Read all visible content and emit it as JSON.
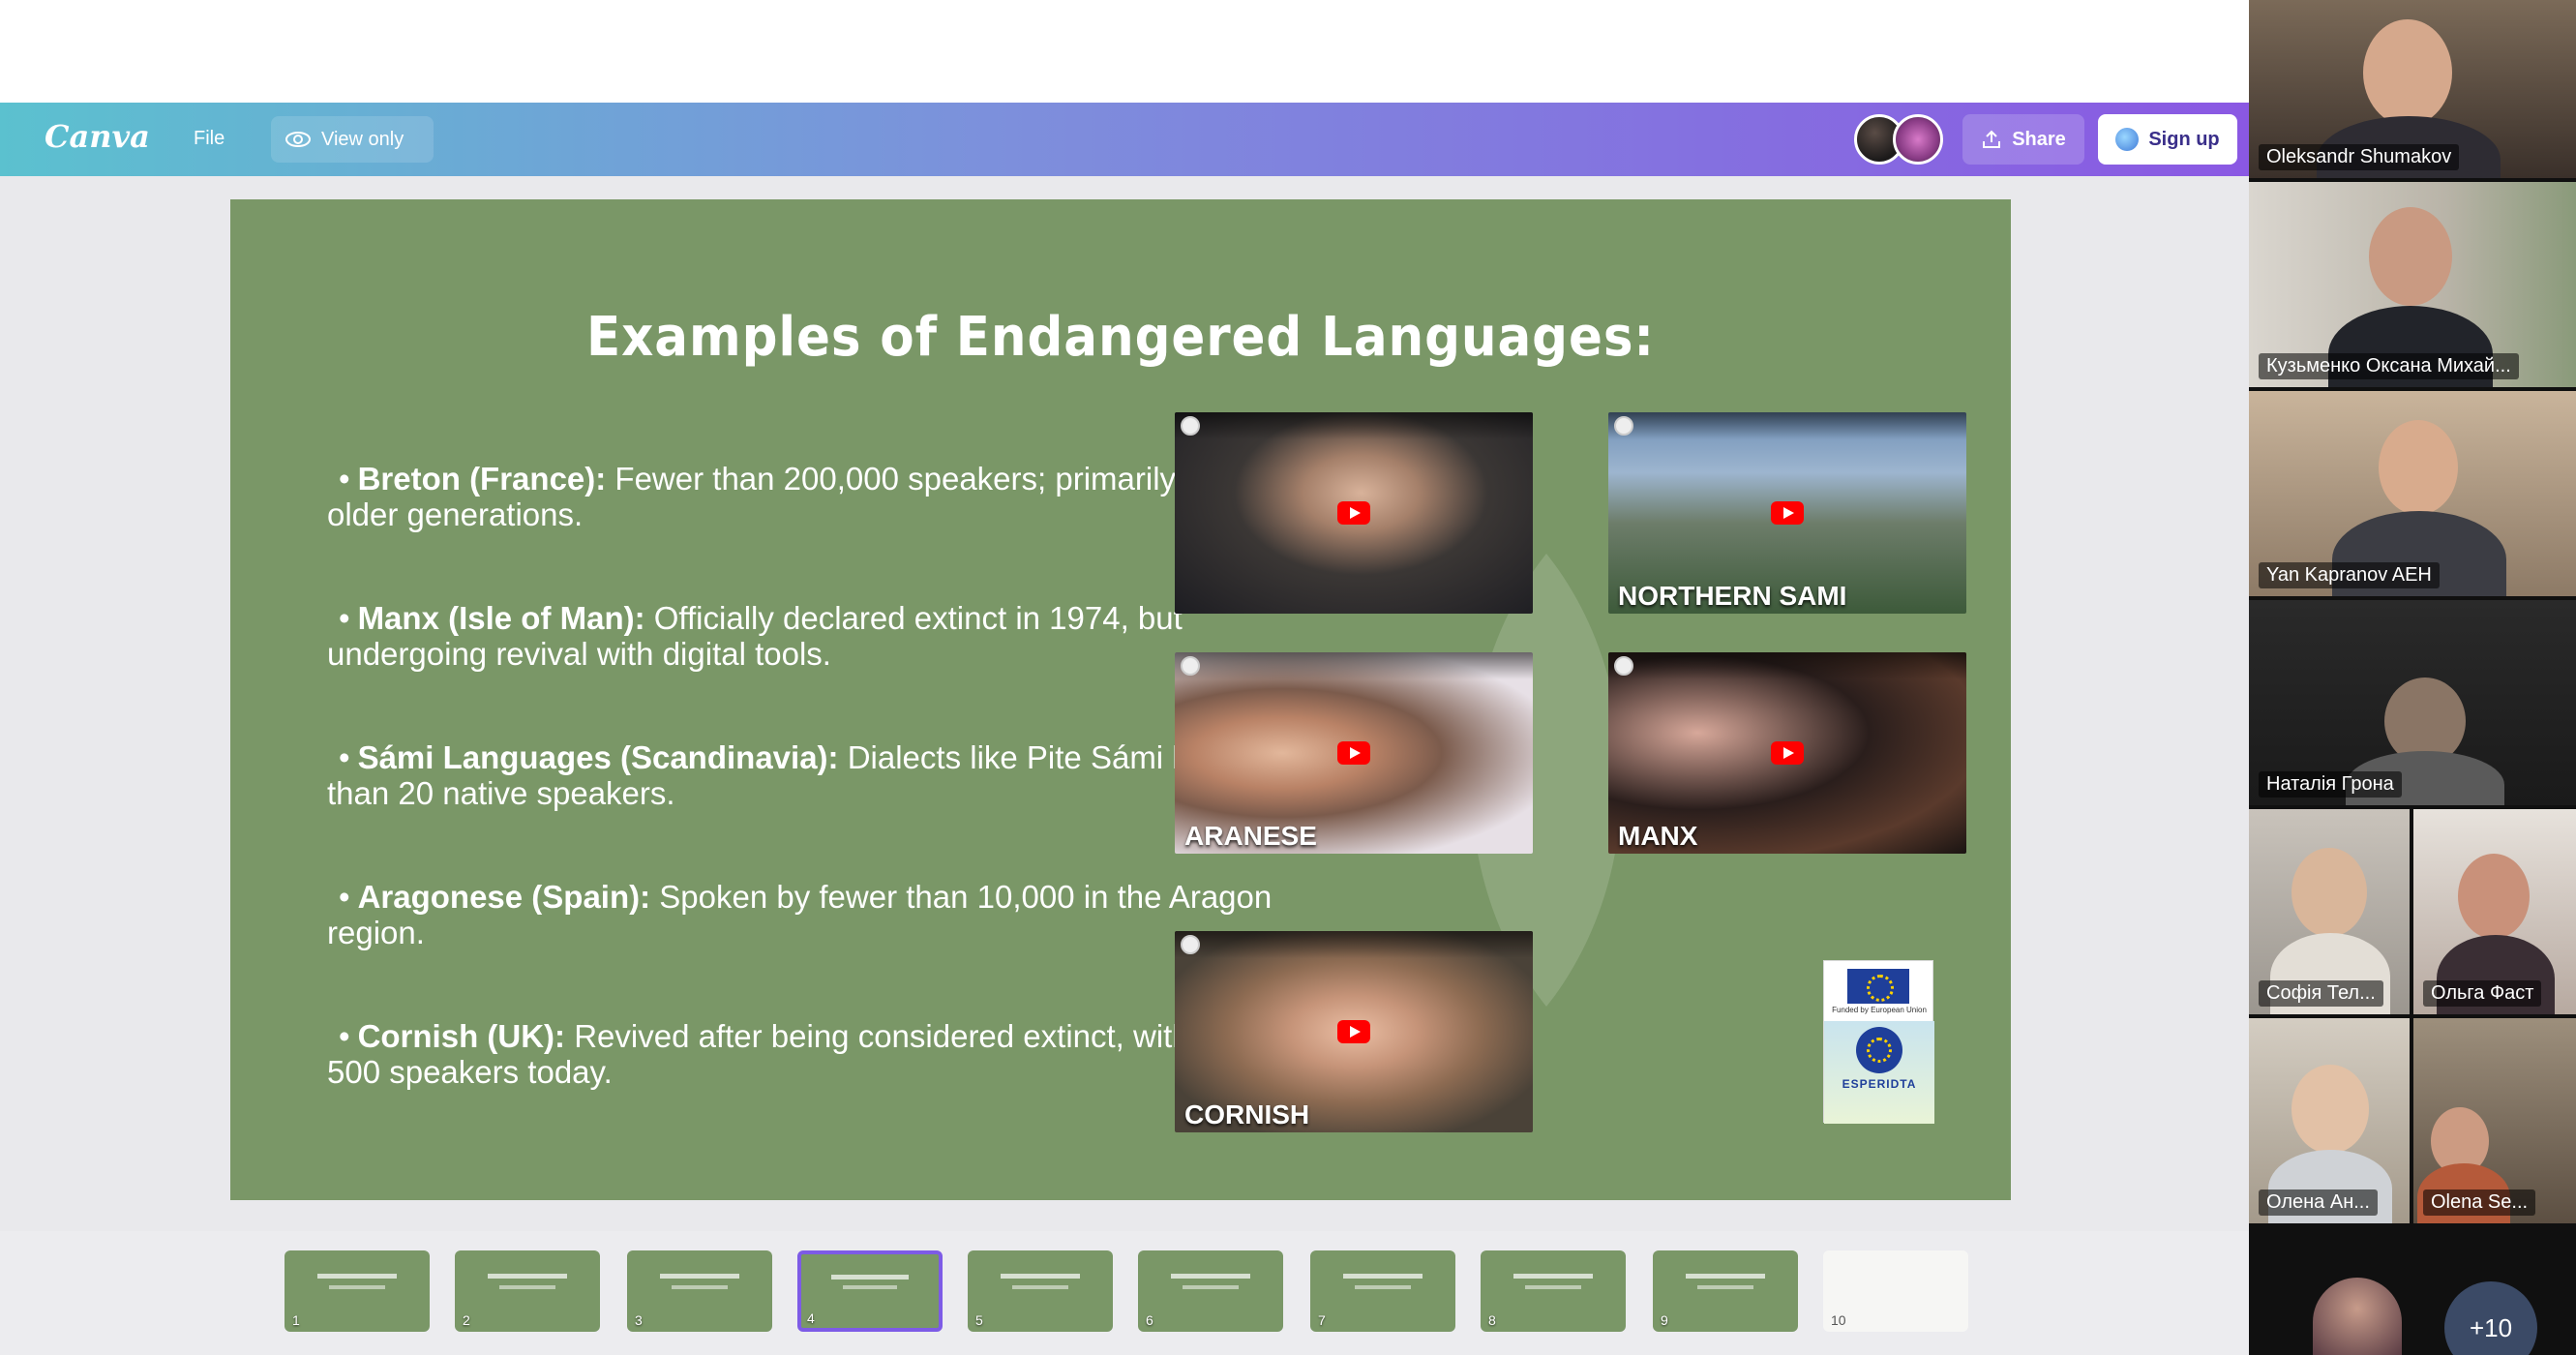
{
  "canva": {
    "logo": "Canva",
    "file_label": "File",
    "view_only_label": "View only",
    "share_label": "Share",
    "signup_label": "Sign up",
    "brand_gradient": [
      "#5bc1cf",
      "#8a58e3"
    ]
  },
  "slide": {
    "title": "Examples of Endangered Languages:",
    "background": "#7a9767",
    "bullets": [
      {
        "term": "Breton (France):",
        "text": " Fewer than 200,000 speakers; primarily spoken by older generations."
      },
      {
        "term": "Manx (Isle of Man):",
        "text": " Officially declared extinct in 1974, but undergoing revival with digital tools."
      },
      {
        "term": "Sámi Languages (Scandinavia):",
        "text": " Dialects like Pite Sámi have fewer than 20 native speakers."
      },
      {
        "term": "Aragonese (Spain):",
        "text": " Spoken by fewer than 10,000 in the Aragon region."
      },
      {
        "term": "Cornish (UK):",
        "text": " Revived after being considered extinct, with about 500 speakers today."
      }
    ],
    "videos": [
      {
        "caption": ""
      },
      {
        "caption": "NORTHERN SAMI"
      },
      {
        "caption": "ARANESE"
      },
      {
        "caption": "MANX"
      },
      {
        "caption": "CORNISH"
      }
    ],
    "eu_logo": {
      "funded_text": "Funded by European Union",
      "name": "ESPERIDTA"
    }
  },
  "thumbnails": [
    {
      "num": "1"
    },
    {
      "num": "2"
    },
    {
      "num": "3"
    },
    {
      "num": "4",
      "active": true
    },
    {
      "num": "5"
    },
    {
      "num": "6"
    },
    {
      "num": "7"
    },
    {
      "num": "8"
    },
    {
      "num": "9"
    },
    {
      "num": "10"
    }
  ],
  "participants": [
    {
      "name": "Oleksandr Shumakov"
    },
    {
      "name": "Кузьменко Оксана Михай..."
    },
    {
      "name": "Yan Kapranov AEH"
    },
    {
      "name": "Наталія Грона"
    },
    {
      "name": "Софія Тел..."
    },
    {
      "name": "Ольга Фаст"
    },
    {
      "name": "Олена Ан..."
    },
    {
      "name": "Olena Se..."
    }
  ],
  "more_participants": "+10"
}
